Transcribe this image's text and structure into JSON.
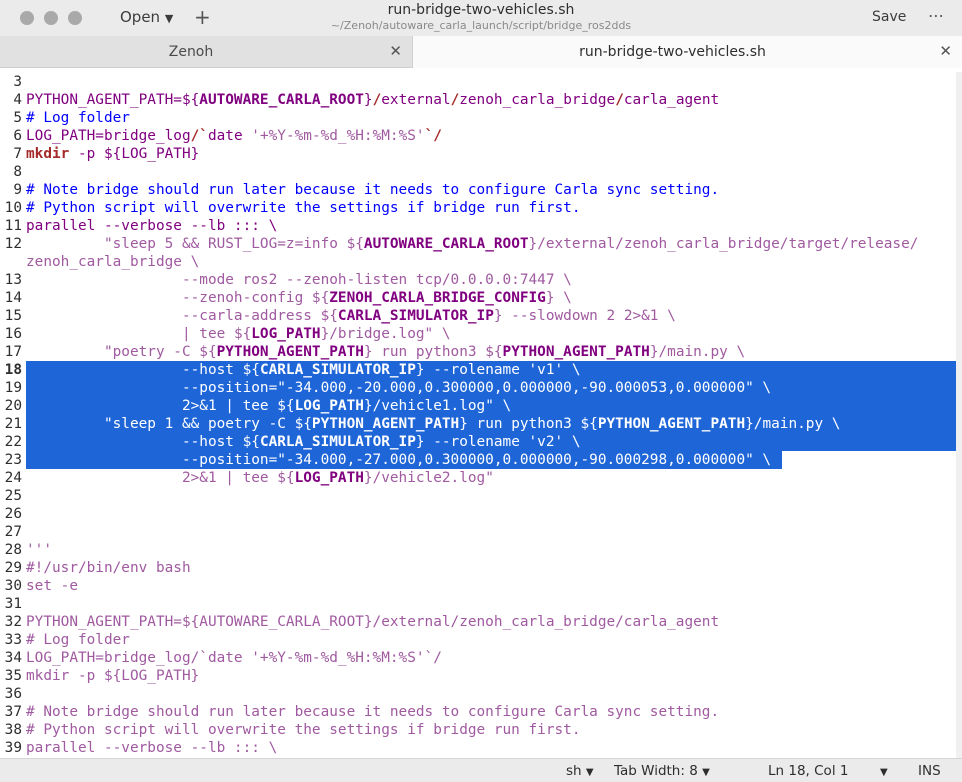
{
  "header": {
    "open_label": "Open",
    "title": "run-bridge-two-vehicles.sh",
    "subtitle": "~/Zenoh/autoware_carla_launch/script/bridge_ros2dds",
    "save_label": "Save"
  },
  "tabs": [
    {
      "label": "Zenoh"
    },
    {
      "label": "run-bridge-two-vehicles.sh"
    }
  ],
  "editor": {
    "lines": [
      {
        "n": "3",
        "segs": []
      },
      {
        "n": "4",
        "segs": [
          [
            "PYTHON_AGENT_PATH=",
            "var"
          ],
          [
            "${",
            "var"
          ],
          [
            "AUTOWARE_CARLA_ROOT",
            "bold"
          ],
          [
            "}",
            "var"
          ],
          [
            "/",
            "kw"
          ],
          [
            "external",
            "var"
          ],
          [
            "/",
            "kw"
          ],
          [
            "zenoh_carla_bridge",
            "var"
          ],
          [
            "/",
            "kw"
          ],
          [
            "carla_agent",
            "var"
          ]
        ]
      },
      {
        "n": "5",
        "segs": [
          [
            "# Log folder",
            "cm"
          ]
        ]
      },
      {
        "n": "6",
        "segs": [
          [
            "LOG_PATH=",
            "var"
          ],
          [
            "bridge_log",
            "var"
          ],
          [
            "/",
            "kw"
          ],
          [
            "`",
            "kw"
          ],
          [
            "date ",
            "var"
          ],
          [
            "'+%Y-%m-%d_%H:%M:%S'",
            "str"
          ],
          [
            "`",
            "kw"
          ],
          [
            "/",
            "kw"
          ]
        ]
      },
      {
        "n": "7",
        "segs": [
          [
            "mkdir",
            "kw"
          ],
          [
            " -p ",
            "var"
          ],
          [
            "${",
            "var"
          ],
          [
            "LOG_PATH",
            "var"
          ],
          [
            "}",
            "var"
          ]
        ]
      },
      {
        "n": "8",
        "segs": []
      },
      {
        "n": "9",
        "segs": [
          [
            "# Note bridge should run later because it needs to configure Carla sync setting.",
            "cm"
          ]
        ]
      },
      {
        "n": "10",
        "segs": [
          [
            "# Python script will overwrite the settings if bridge run first.",
            "cm"
          ]
        ]
      },
      {
        "n": "11",
        "segs": [
          [
            "parallel --verbose --lb ::: \\",
            "var"
          ]
        ]
      },
      {
        "n": "12",
        "segs": [
          [
            "         \"sleep 5 && RUST_LOG=z=info ",
            "str"
          ],
          [
            "${",
            "str"
          ],
          [
            "AUTOWARE_CARLA_ROOT",
            "bold"
          ],
          [
            "}",
            "str"
          ],
          [
            "/external/zenoh_carla_bridge/target/release/",
            "str"
          ]
        ]
      },
      {
        "n": "",
        "segs": [
          [
            "zenoh_carla_bridge \\",
            "str"
          ]
        ]
      },
      {
        "n": "13",
        "segs": [
          [
            "                  --mode ros2 --zenoh-listen tcp/0.0.0.0:7447 \\",
            "str"
          ]
        ]
      },
      {
        "n": "14",
        "segs": [
          [
            "                  --zenoh-config ",
            "str"
          ],
          [
            "${",
            "str"
          ],
          [
            "ZENOH_CARLA_BRIDGE_CONFIG",
            "bold"
          ],
          [
            "} \\",
            "str"
          ]
        ]
      },
      {
        "n": "15",
        "segs": [
          [
            "                  --carla-address ",
            "str"
          ],
          [
            "${",
            "str"
          ],
          [
            "CARLA_SIMULATOR_IP",
            "bold"
          ],
          [
            "} --slowdown 2 2>&1 \\",
            "str"
          ]
        ]
      },
      {
        "n": "16",
        "segs": [
          [
            "                  | tee ",
            "str"
          ],
          [
            "${",
            "str"
          ],
          [
            "LOG_PATH",
            "bold"
          ],
          [
            "}/bridge.log\" \\",
            "str"
          ]
        ]
      },
      {
        "n": "17",
        "segs": [
          [
            "         \"poetry -C ",
            "str"
          ],
          [
            "${",
            "str"
          ],
          [
            "PYTHON_AGENT_PATH",
            "bold"
          ],
          [
            "} run python3 ",
            "str"
          ],
          [
            "${",
            "str"
          ],
          [
            "PYTHON_AGENT_PATH",
            "bold"
          ],
          [
            "}/main.py \\",
            "str"
          ]
        ]
      },
      {
        "n": "18",
        "segs": [
          [
            "                  --host ",
            "str"
          ],
          [
            "${",
            "str"
          ],
          [
            "CARLA_SIMULATOR_IP",
            "bold"
          ],
          [
            "} --rolename 'v1' \\",
            "str"
          ]
        ],
        "sel": true
      },
      {
        "n": "19",
        "segs": [
          [
            "                  --position=\"-34.000,-20.000,0.300000,0.000000,-90.000053,0.000000\" \\",
            "str"
          ]
        ],
        "sel": true
      },
      {
        "n": "20",
        "segs": [
          [
            "                  2>&1 | tee ",
            "str"
          ],
          [
            "${",
            "str"
          ],
          [
            "LOG_PATH",
            "bold"
          ],
          [
            "}/vehicle1.log\" \\",
            "str"
          ]
        ],
        "sel": true
      },
      {
        "n": "21",
        "segs": [
          [
            "         \"sleep 1 && poetry -C ",
            "str"
          ],
          [
            "${",
            "str"
          ],
          [
            "PYTHON_AGENT_PATH",
            "bold"
          ],
          [
            "} run python3 ",
            "str"
          ],
          [
            "${",
            "str"
          ],
          [
            "PYTHON_AGENT_PATH",
            "bold"
          ],
          [
            "}/main.py \\",
            "str"
          ]
        ],
        "sel": true
      },
      {
        "n": "22",
        "segs": [
          [
            "                  --host ",
            "str"
          ],
          [
            "${",
            "str"
          ],
          [
            "CARLA_SIMULATOR_IP",
            "bold"
          ],
          [
            "} --rolename 'v2' \\",
            "str"
          ]
        ],
        "sel": true
      },
      {
        "n": "23",
        "segs": [
          [
            "                  --position=\"-34.000,-27.000,0.300000,0.000000,-90.000298,0.000000\" \\",
            "str"
          ]
        ],
        "sel": true,
        "selpart": true
      },
      {
        "n": "24",
        "segs": [
          [
            "                  2>&1 | tee ",
            "str"
          ],
          [
            "${",
            "str"
          ],
          [
            "LOG_PATH",
            "bold"
          ],
          [
            "}/vehicle2.log\"",
            "str"
          ]
        ]
      },
      {
        "n": "25",
        "segs": []
      },
      {
        "n": "26",
        "segs": []
      },
      {
        "n": "27",
        "segs": []
      },
      {
        "n": "28",
        "segs": [
          [
            "'''",
            "str"
          ]
        ]
      },
      {
        "n": "29",
        "segs": [
          [
            "#!/usr/bin/env bash",
            "str"
          ]
        ]
      },
      {
        "n": "30",
        "segs": [
          [
            "set -e",
            "str"
          ]
        ]
      },
      {
        "n": "31",
        "segs": []
      },
      {
        "n": "32",
        "segs": [
          [
            "PYTHON_AGENT_PATH=${AUTOWARE_CARLA_ROOT}/external/zenoh_carla_bridge/carla_agent",
            "str"
          ]
        ]
      },
      {
        "n": "33",
        "segs": [
          [
            "# Log folder",
            "str"
          ]
        ]
      },
      {
        "n": "34",
        "segs": [
          [
            "LOG_PATH=bridge_log/`date '+%Y-%m-%d_%H:%M:%S'`/",
            "str"
          ]
        ]
      },
      {
        "n": "35",
        "segs": [
          [
            "mkdir -p ${LOG_PATH}",
            "str"
          ]
        ]
      },
      {
        "n": "36",
        "segs": []
      },
      {
        "n": "37",
        "segs": [
          [
            "# Note bridge should run later because it needs to configure Carla sync setting.",
            "str"
          ]
        ]
      },
      {
        "n": "38",
        "segs": [
          [
            "# Python script will overwrite the settings if bridge run first.",
            "str"
          ]
        ]
      },
      {
        "n": "39",
        "segs": [
          [
            "parallel --verbose --lb ::: \\",
            "str"
          ]
        ]
      }
    ],
    "current_line": "18"
  },
  "status": {
    "language": "sh",
    "tab_width": "Tab Width: 8",
    "position": "Ln 18, Col 1",
    "mode": "INS"
  },
  "colors": {
    "selection": "#1e66d8",
    "variable": "#800080",
    "comment": "#0000ff",
    "keyword": "#a52a2a",
    "string": "#a05aa0"
  }
}
